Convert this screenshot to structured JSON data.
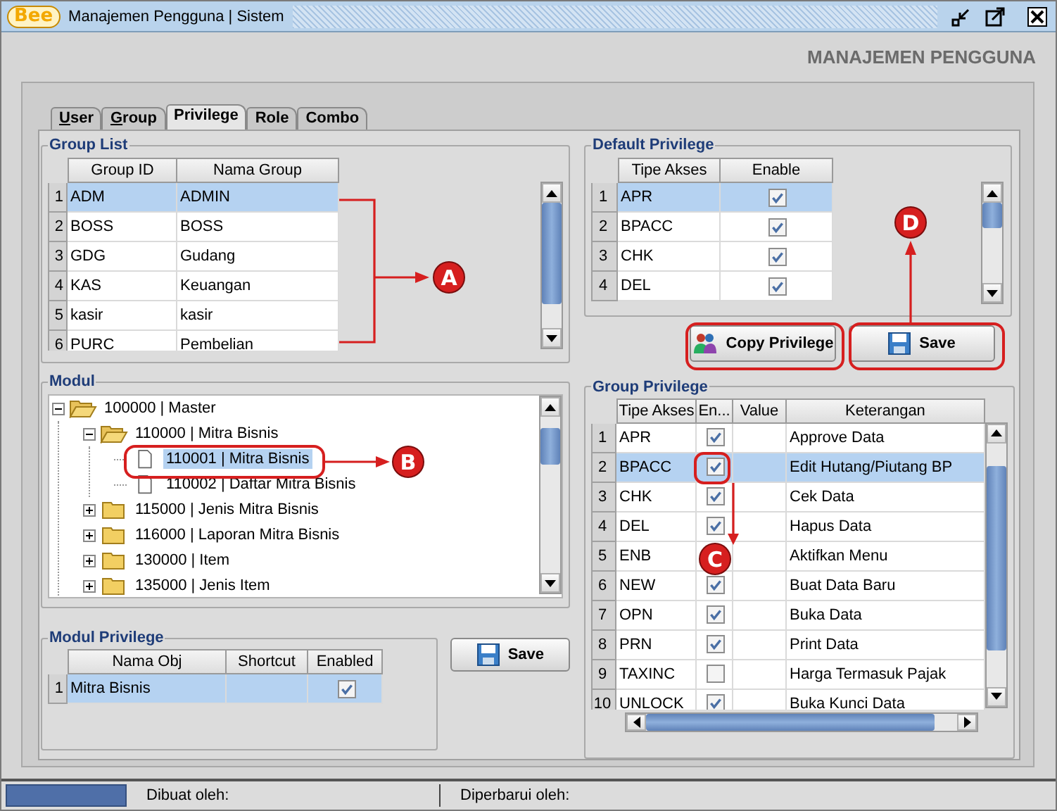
{
  "window": {
    "logo": "Bee",
    "title": "Manajemen Pengguna | Sistem"
  },
  "header": "MANAJEMEN PENGGUNA",
  "tabs": [
    {
      "label": "User",
      "underlined_initial": true,
      "selected": false
    },
    {
      "label": "Group",
      "underlined_initial": true,
      "selected": false
    },
    {
      "label": "Privilege",
      "underlined_initial": false,
      "selected": true
    },
    {
      "label": "Role",
      "underlined_initial": false,
      "selected": false
    },
    {
      "label": "Combo",
      "underlined_initial": false,
      "selected": false
    }
  ],
  "group_list": {
    "title": "Group List",
    "columns": [
      "Group ID",
      "Nama Group"
    ],
    "rows": [
      {
        "number": "1",
        "cells": [
          "ADM",
          "ADMIN"
        ],
        "selected": true
      },
      {
        "number": "2",
        "cells": [
          "BOSS",
          "BOSS"
        ],
        "selected": false
      },
      {
        "number": "3",
        "cells": [
          "GDG",
          "Gudang"
        ],
        "selected": false
      },
      {
        "number": "4",
        "cells": [
          "KAS",
          "Keuangan"
        ],
        "selected": false
      },
      {
        "number": "5",
        "cells": [
          "kasir",
          "kasir"
        ],
        "selected": false
      },
      {
        "number": "6",
        "cells": [
          "PURC",
          "Pembelian"
        ],
        "selected": false
      }
    ]
  },
  "modul": {
    "title": "Modul",
    "tree": [
      {
        "label": "100000 | Master",
        "kind": "folder",
        "expanded": true,
        "selected": false,
        "children": [
          {
            "label": "110000 | Mitra Bisnis",
            "kind": "folder",
            "expanded": true,
            "selected": false,
            "children": [
              {
                "label": "110001 | Mitra Bisnis",
                "kind": "file",
                "selected": true
              },
              {
                "label": "110002 | Daftar Mitra Bisnis",
                "kind": "file",
                "selected": false
              }
            ]
          },
          {
            "label": "115000 | Jenis Mitra Bisnis",
            "kind": "folder",
            "expanded": false,
            "selected": false
          },
          {
            "label": "116000 | Laporan Mitra Bisnis",
            "kind": "folder",
            "expanded": false,
            "selected": false
          },
          {
            "label": "130000 | Item",
            "kind": "folder",
            "expanded": false,
            "selected": false
          },
          {
            "label": "135000 | Jenis Item",
            "kind": "folder",
            "expanded": false,
            "selected": false
          }
        ]
      }
    ]
  },
  "modul_privilege": {
    "title": "Modul Privilege",
    "columns": [
      "Nama Obj",
      "Shortcut",
      "Enabled"
    ],
    "rows": [
      {
        "number": "1",
        "nama_obj": "Mitra Bisnis",
        "enabled": true,
        "selected": true
      }
    ]
  },
  "modul_save_button": "Save",
  "default_privilege": {
    "title": "Default Privilege",
    "columns": [
      "Tipe Akses",
      "Enable"
    ],
    "rows": [
      {
        "number": "1",
        "tipe": "APR",
        "enabled": true,
        "selected": true
      },
      {
        "number": "2",
        "tipe": "BPACC",
        "enabled": true,
        "selected": false
      },
      {
        "number": "3",
        "tipe": "CHK",
        "enabled": true,
        "selected": false
      },
      {
        "number": "4",
        "tipe": "DEL",
        "enabled": true,
        "selected": false
      }
    ]
  },
  "copy_privilege_button": "Copy Privilege",
  "default_save_button": "Save",
  "group_privilege": {
    "title": "Group Privilege",
    "columns": [
      "Tipe Akses",
      "En...",
      "Value",
      "Keterangan"
    ],
    "rows": [
      {
        "number": "1",
        "tipe": "APR",
        "enabled": true,
        "keterangan": "Approve Data",
        "selected": false
      },
      {
        "number": "2",
        "tipe": "BPACC",
        "enabled": true,
        "keterangan": "Edit Hutang/Piutang BP",
        "selected": true
      },
      {
        "number": "3",
        "tipe": "CHK",
        "enabled": true,
        "keterangan": "Cek Data",
        "selected": false
      },
      {
        "number": "4",
        "tipe": "DEL",
        "enabled": true,
        "keterangan": "Hapus Data",
        "selected": false
      },
      {
        "number": "5",
        "tipe": "ENB",
        "keterangan": "Aktifkan Menu",
        "selected": false
      },
      {
        "number": "6",
        "tipe": "NEW",
        "enabled": true,
        "keterangan": "Buat Data Baru",
        "selected": false
      },
      {
        "number": "7",
        "tipe": "OPN",
        "enabled": true,
        "keterangan": "Buka Data",
        "selected": false
      },
      {
        "number": "8",
        "tipe": "PRN",
        "enabled": true,
        "keterangan": "Print Data",
        "selected": false
      },
      {
        "number": "9",
        "tipe": "TAXINC",
        "enabled": false,
        "keterangan": "Harga Termasuk Pajak",
        "selected": false
      },
      {
        "number": "10",
        "tipe": "UNLOCK",
        "enabled": true,
        "keterangan": "Buka Kunci Data",
        "selected": false
      }
    ]
  },
  "status_bar": [
    "Dibuat oleh:",
    "Diperbarui oleh:"
  ],
  "callouts": [
    {
      "label": "A"
    },
    {
      "label": "B"
    },
    {
      "label": "C"
    },
    {
      "label": "D"
    }
  ]
}
